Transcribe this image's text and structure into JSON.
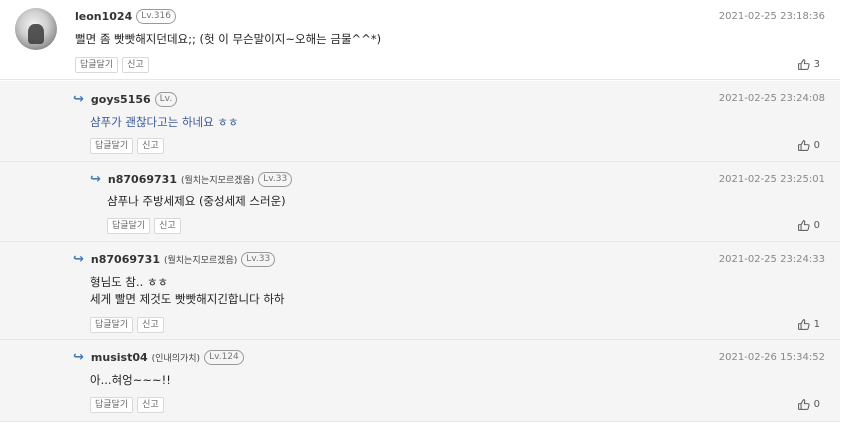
{
  "comments": [
    {
      "user": "leon1024",
      "nickname": "",
      "level": "Lv.316",
      "date": "2021-02-25 23:18:36",
      "lines": [
        "뻘면 좀 빳빳해지던데요;; (헛 이 무슨말이지~오해는 금물^^*)"
      ],
      "reply_label": "답글달기",
      "report_label": "신고",
      "likes": "3"
    },
    {
      "user": "goys5156",
      "nickname": "",
      "level": "Lv.",
      "date": "2021-02-25 23:24:08",
      "lines": [
        "샴푸가 괜찮다고는 하네요 ㅎㅎ"
      ],
      "reply_label": "답글달기",
      "report_label": "신고",
      "likes": "0"
    },
    {
      "user": "n87069731",
      "nickname": "(뭘치는지모르겠음)",
      "level": "Lv.33",
      "date": "2021-02-25 23:25:01",
      "lines": [
        "샴푸나 주방세제요 (중성세제 스러운)"
      ],
      "reply_label": "답글달기",
      "report_label": "신고",
      "likes": "0"
    },
    {
      "user": "n87069731",
      "nickname": "(뭘치는지모르겠음)",
      "level": "Lv.33",
      "date": "2021-02-25 23:24:33",
      "lines": [
        "형님도 참.. ㅎㅎ",
        "세게 빨면 제것도 빳빳해지긴합니다 하하"
      ],
      "reply_label": "답글달기",
      "report_label": "신고",
      "likes": "1"
    },
    {
      "user": "musist04",
      "nickname": "(인내의가치)",
      "level": "Lv.124",
      "date": "2021-02-26 15:34:52",
      "lines": [
        "아...혀엉~~~!!"
      ],
      "reply_label": "답글달기",
      "report_label": "신고",
      "likes": "0"
    }
  ],
  "icons": {
    "reply_arrow": "reply-arrow-icon",
    "like": "thumbs-up-icon"
  },
  "colors": {
    "reply_bg": "#f5f5f5",
    "arrow": "#4a7bb7",
    "reply_text": "#3b5998"
  }
}
